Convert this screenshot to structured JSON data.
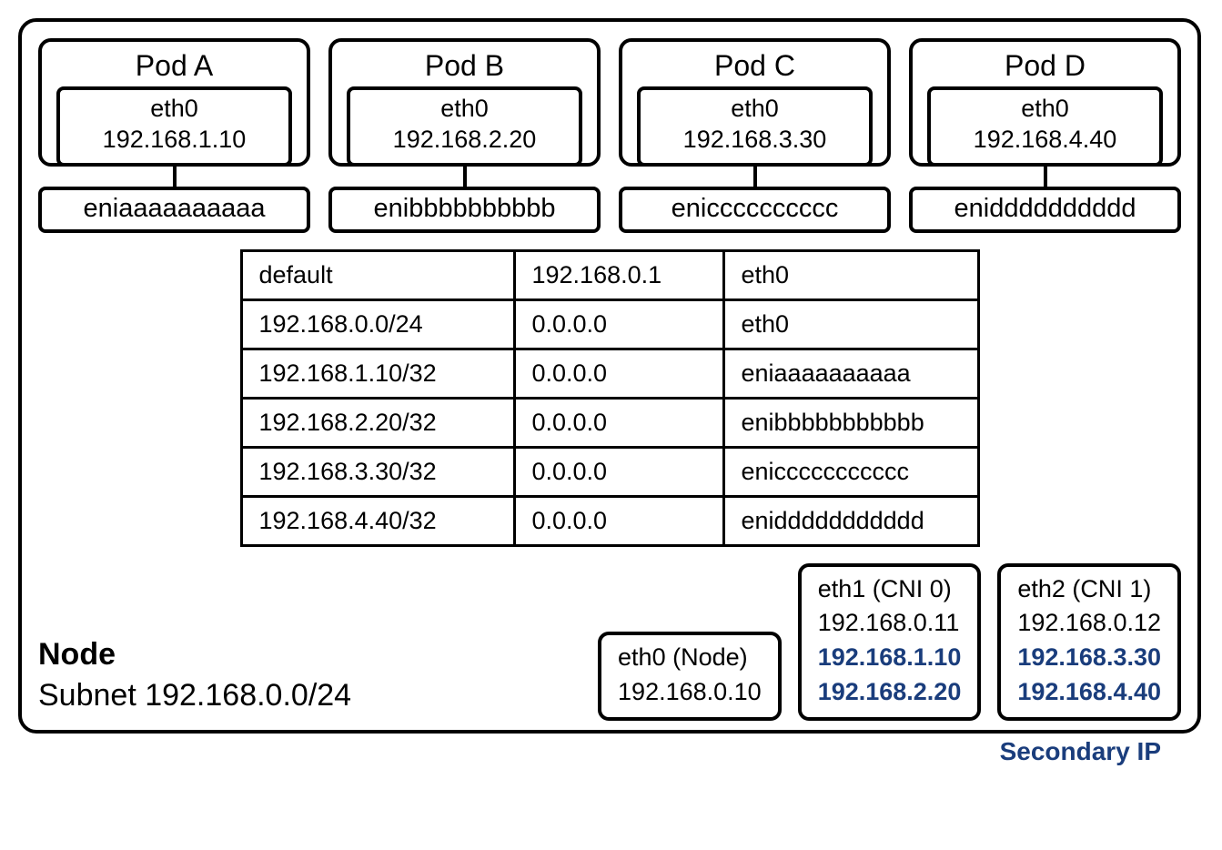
{
  "pods": [
    {
      "name": "Pod A",
      "iface": "eth0",
      "ip": "192.168.1.10",
      "eni": "eniaaaaaaaaaa"
    },
    {
      "name": "Pod B",
      "iface": "eth0",
      "ip": "192.168.2.20",
      "eni": "enibbbbbbbbbb"
    },
    {
      "name": "Pod C",
      "iface": "eth0",
      "ip": "192.168.3.30",
      "eni": "enicccccccccc"
    },
    {
      "name": "Pod D",
      "iface": "eth0",
      "ip": "192.168.4.40",
      "eni": "enidddddddddd"
    }
  ],
  "routes": [
    {
      "dest": "default",
      "gw": "192.168.0.1",
      "dev": "eth0"
    },
    {
      "dest": "192.168.0.0/24",
      "gw": "0.0.0.0",
      "dev": "eth0"
    },
    {
      "dest": "192.168.1.10/32",
      "gw": "0.0.0.0",
      "dev": "eniaaaaaaaaaa"
    },
    {
      "dest": "192.168.2.20/32",
      "gw": "0.0.0.0",
      "dev": "enibbbbbbbbbbb"
    },
    {
      "dest": "192.168.3.30/32",
      "gw": "0.0.0.0",
      "dev": "eniccccccccccc"
    },
    {
      "dest": "192.168.4.40/32",
      "gw": "0.0.0.0",
      "dev": "eniddddddddddd"
    }
  ],
  "node": {
    "title": "Node",
    "subnet_label": "Subnet 192.168.0.0/24"
  },
  "interfaces": {
    "eth0": {
      "label": "eth0 (Node)",
      "ip": "192.168.0.10"
    },
    "eth1": {
      "label": "eth1 (CNI 0)",
      "ip": "192.168.0.11",
      "sec1": "192.168.1.10",
      "sec2": "192.168.2.20"
    },
    "eth2": {
      "label": "eth2 (CNI 1)",
      "ip": "192.168.0.12",
      "sec1": "192.168.3.30",
      "sec2": "192.168.4.40"
    }
  },
  "secondary_label": "Secondary IP"
}
